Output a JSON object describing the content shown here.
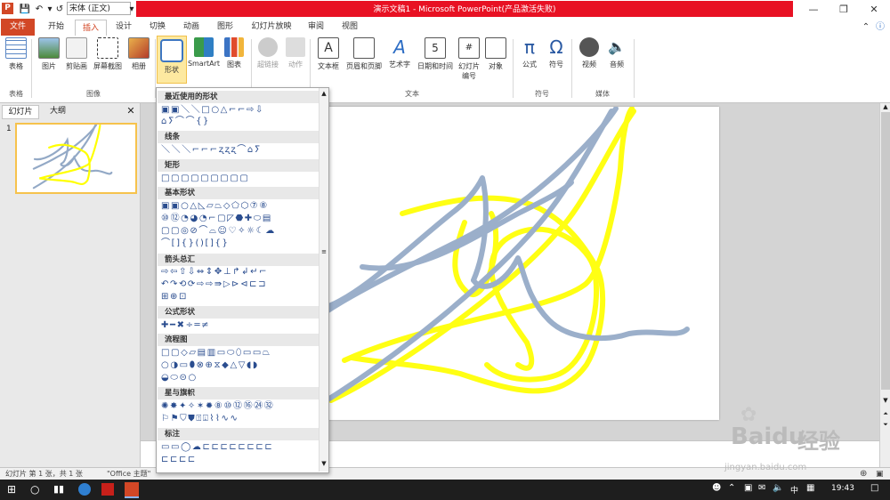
{
  "titlebar": {
    "font_value": "宋体 (正文)",
    "title": "演示文稿1 - Microsoft PowerPoint(产品激活失败)"
  },
  "tabs": [
    "文件",
    "开始",
    "插入",
    "设计",
    "切换",
    "动画",
    "图形",
    "幻灯片放映",
    "审阅",
    "视图"
  ],
  "ribbon": {
    "buttons": [
      "表格",
      "图片",
      "剪贴画",
      "屏幕截图",
      "相册",
      "形状",
      "SmartArt",
      "图表",
      "超链接",
      "动作",
      "文本框",
      "页眉和页脚",
      "艺术字",
      "日期和时间",
      "幻灯片编号",
      "对象",
      "公式",
      "符号",
      "视频",
      "音频"
    ],
    "groups": [
      "表格",
      "图像",
      "文本",
      "符号",
      "媒体"
    ]
  },
  "left_panel": {
    "tabs": [
      "幻灯片",
      "大纲"
    ],
    "slide_number": "1"
  },
  "shapes_menu": {
    "categories": [
      "最近使用的形状",
      "线条",
      "矩形",
      "基本形状",
      "箭头总汇",
      "公式形状",
      "流程图",
      "星与旗帜",
      "标注"
    ]
  },
  "status": {
    "slide_info": "幻灯片 第 1 张，共 1 张",
    "theme": "\"Office 主题\""
  },
  "taskbar": {
    "lang": "中",
    "time": "19:43"
  },
  "watermark": {
    "brand": "Baidu",
    "brand_cn": "经验",
    "url": "jingyan.baidu.com"
  },
  "colors": {
    "accent": "#d24726",
    "title_red": "#e81123",
    "stroke_blue": "#93a9c6",
    "stroke_yellow": "#ffff00"
  }
}
